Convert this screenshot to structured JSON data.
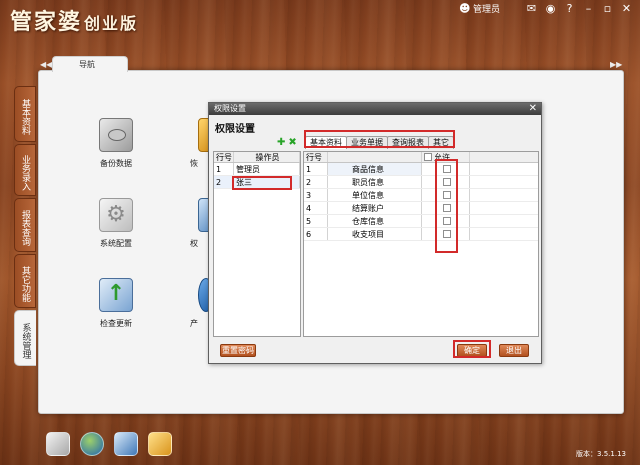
{
  "app": {
    "title_main": "管家婆",
    "title_sub": "创业版"
  },
  "topbar": {
    "user_label": "管理员",
    "icons": [
      "user-icon",
      "mail-icon",
      "weibo-icon",
      "help-icon",
      "minimize-icon",
      "restore-icon",
      "close-icon"
    ]
  },
  "nav_tab": "导航",
  "side_tabs": [
    "基本资料",
    "业务录入",
    "报表查询",
    "其它功能",
    "系统管理"
  ],
  "desktop_icons": [
    {
      "label": "备份数据"
    },
    {
      "label": "系统配置"
    },
    {
      "label": "检查更新"
    },
    {
      "label": "恢"
    },
    {
      "label": "权"
    },
    {
      "label": "产"
    }
  ],
  "dialog": {
    "title": "权限设置",
    "heading": "权限设置",
    "left_headers": [
      "行号",
      "操作员"
    ],
    "operators": [
      {
        "num": "1",
        "name": "管理员"
      },
      {
        "num": "2",
        "name": "张三"
      }
    ],
    "tabs": [
      "基本资料",
      "业务单据",
      "查询报表",
      "其它"
    ],
    "right_headers": [
      "行号",
      "",
      "允许"
    ],
    "permissions": [
      {
        "num": "1",
        "name": "商品信息"
      },
      {
        "num": "2",
        "name": "职员信息"
      },
      {
        "num": "3",
        "name": "单位信息"
      },
      {
        "num": "4",
        "name": "结算账户"
      },
      {
        "num": "5",
        "name": "仓库信息"
      },
      {
        "num": "6",
        "name": "收支项目"
      }
    ],
    "reset_button": "重置密码",
    "ok_button": "确定",
    "exit_button": "退出"
  },
  "version": "版本：3.5.1.13",
  "colors": {
    "accent": "#b2511f",
    "highlight": "#d22a2a",
    "wood": "#8a4522"
  }
}
